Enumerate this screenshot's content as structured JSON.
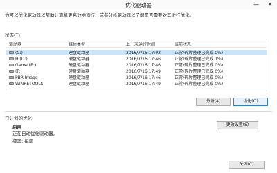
{
  "window": {
    "title": "优化驱动器",
    "minimize_glyph": "—",
    "close_glyph": "✕"
  },
  "description": "你可以优化驱动器以帮助计算机更高效地运行，或者分析驱动器以了解是否需要对其进行优化。",
  "status_label": "状态(T)",
  "columns": {
    "drive": "驱动器",
    "media_type": "媒体类型",
    "last_run": "上一次运行时间",
    "current_status": "当前状态"
  },
  "drives": [
    {
      "name": "(C:)",
      "media_type": "硬盘驱动器",
      "last_run": "2016/7/16 17:02",
      "status": "正常(碎片整理已完成 0%)",
      "selected": true,
      "icon": "hard-drive-icon"
    },
    {
      "name": "H (D:)",
      "media_type": "硬盘驱动器",
      "last_run": "2016/7/16 17:46",
      "status": "正常(碎片整理已完成 1%)",
      "selected": false,
      "icon": "hard-drive-icon"
    },
    {
      "name": "Game (E:)",
      "media_type": "硬盘驱动器",
      "last_run": "2016/7/16 17:46",
      "status": "正常(碎片整理已完成 0%)",
      "selected": false,
      "icon": "hard-drive-icon"
    },
    {
      "name": "(F:)",
      "media_type": "硬盘驱动器",
      "last_run": "2016/7/16 17:49",
      "status": "正常(碎片整理已完成 0%)",
      "selected": false,
      "icon": "hard-drive-icon"
    },
    {
      "name": "PBR Image",
      "media_type": "硬盘驱动器",
      "last_run": "2016/7/16 17:46",
      "status": "正常(碎片整理已完成 0%)",
      "selected": false,
      "icon": "hard-drive-icon"
    },
    {
      "name": "WINRETOOLS",
      "media_type": "硬盘驱动器",
      "last_run": "2016/7/16 17:49",
      "status": "正常(碎片整理已完成 0%)",
      "selected": false,
      "icon": "hard-drive-icon"
    }
  ],
  "buttons": {
    "analyze": "分析(A)",
    "optimize": "优化(O)",
    "change_settings": "更改设置(S)",
    "close": "关闭(C)"
  },
  "scheduled": {
    "label": "已计划的优化",
    "state": "启用",
    "description": "正在自动优化驱动器。",
    "frequency": "频率: 每周"
  },
  "colors": {
    "selection": "#cce4f7",
    "primary_button_border": "#3c7fb1"
  }
}
